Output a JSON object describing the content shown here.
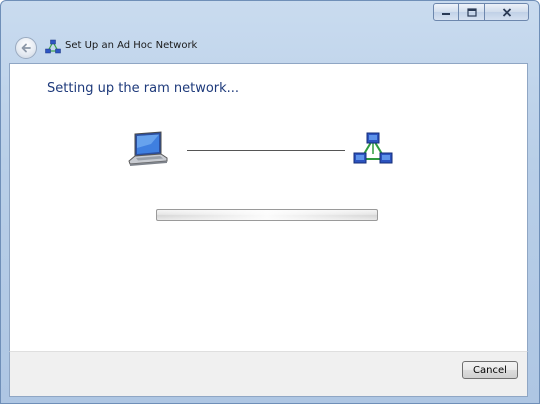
{
  "window": {
    "title": "Set Up an Ad Hoc Network",
    "controls": {
      "minimize_icon": "minimize-icon",
      "maximize_icon": "maximize-icon",
      "close_icon": "close-icon"
    }
  },
  "nav": {
    "back_icon": "back-arrow-icon",
    "wizard_icon": "adhoc-network-icon"
  },
  "main": {
    "heading": "Setting up the ram network...",
    "progress": {
      "value": 1.0,
      "style": "indeterminate"
    },
    "icons": {
      "left": "laptop-icon",
      "right": "adhoc-network-icon"
    }
  },
  "footer": {
    "cancel_label": "Cancel"
  },
  "colors": {
    "heading": "#1e3a7b",
    "frame": "#b9cfe8",
    "footer": "#f0f0f0"
  }
}
